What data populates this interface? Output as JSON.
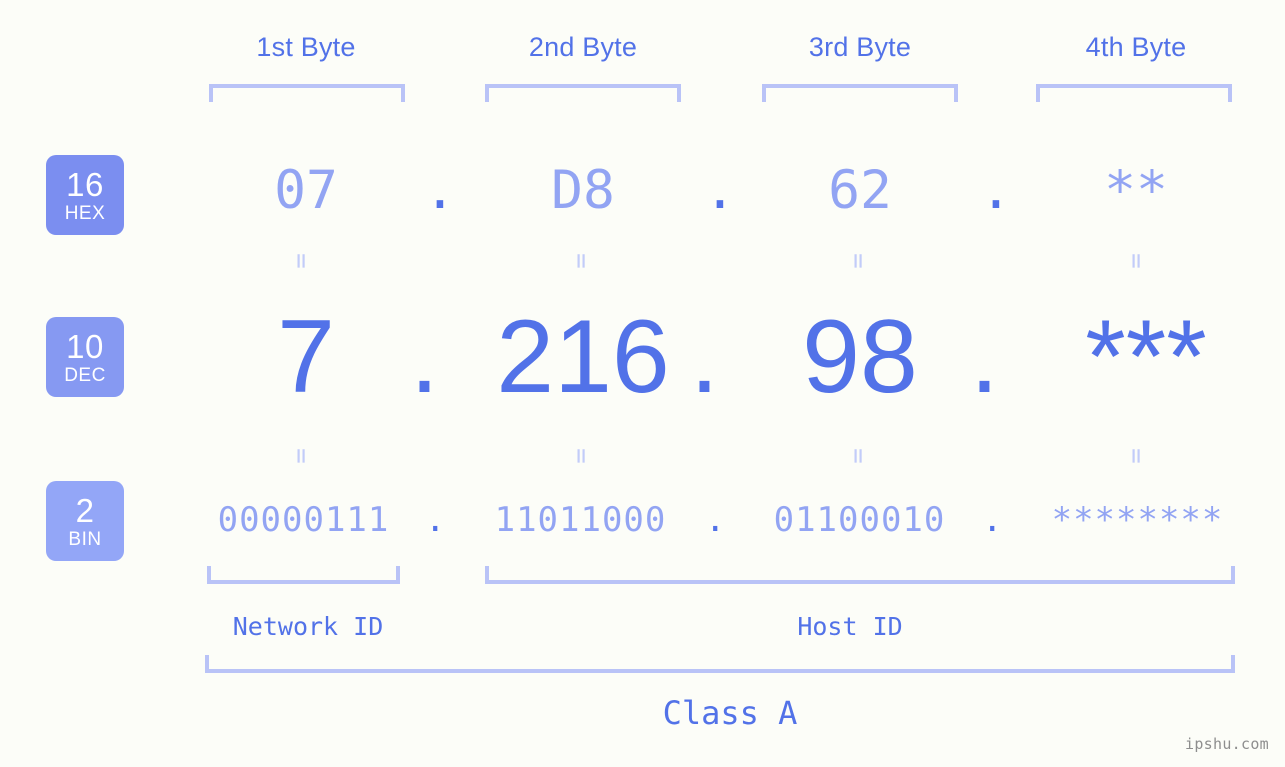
{
  "page": {
    "background_color": "#fcfdf8",
    "accent_strong": "#5272e8",
    "accent_mid": "#92a4f3",
    "accent_light": "#b9c3f7",
    "watermark": "ipshu.com"
  },
  "byte_headers": [
    {
      "label": "1st Byte"
    },
    {
      "label": "2nd Byte"
    },
    {
      "label": "3rd Byte"
    },
    {
      "label": "4th Byte"
    }
  ],
  "bases": [
    {
      "id": "hex",
      "number": "16",
      "abbr": "HEX",
      "color": "#7b8ef0"
    },
    {
      "id": "dec",
      "number": "10",
      "abbr": "DEC",
      "color": "#8699f2"
    },
    {
      "id": "bin",
      "number": "2",
      "abbr": "BIN",
      "color": "#93a6f7"
    }
  ],
  "rows": {
    "hex": {
      "values": [
        "07",
        "D8",
        "62",
        "**"
      ],
      "separators": [
        ".",
        ".",
        "."
      ]
    },
    "dec": {
      "values": [
        "7",
        "216",
        "98",
        "***"
      ],
      "separators": [
        ".",
        ".",
        "."
      ]
    },
    "bin": {
      "values": [
        "00000111",
        "11011000",
        "01100010",
        "********"
      ],
      "separators": [
        ".",
        ".",
        "."
      ]
    }
  },
  "equality_marks": {
    "symbol": "=",
    "rows": [
      "hex-to-dec",
      "dec-to-bin"
    ],
    "count_per_row": 4
  },
  "sections": [
    {
      "id": "network-id",
      "label": "Network ID"
    },
    {
      "id": "host-id",
      "label": "Host ID"
    }
  ],
  "class_label": "Class A"
}
